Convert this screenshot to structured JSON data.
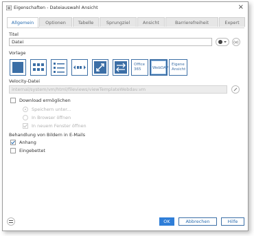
{
  "window": {
    "title": "Eigenschaften - Dateiauswahl Ansicht",
    "close_icon": "×"
  },
  "tabs": [
    {
      "label": "Allgemein",
      "active": true
    },
    {
      "label": "Optionen",
      "active": false
    },
    {
      "label": "Tabelle",
      "active": false
    },
    {
      "label": "Sprungziel",
      "active": false
    },
    {
      "label": "Ansicht",
      "active": false
    },
    {
      "label": "Barrierefreiheit",
      "active": false
    },
    {
      "label": "Expert",
      "active": false
    }
  ],
  "fields": {
    "titel_label": "Titel",
    "titel_value": "Datei",
    "vorlage_label": "Vorlage",
    "velocity_label": "Velocity-Datei",
    "velocity_value": "internal/system/vm/html/fileviews/viewTemplateWebdav.vm"
  },
  "templates": [
    {
      "name": "single-block",
      "text": ""
    },
    {
      "name": "grid",
      "text": ""
    },
    {
      "name": "list",
      "text": ""
    },
    {
      "name": "slider",
      "text": ""
    },
    {
      "name": "expand",
      "text": ""
    },
    {
      "name": "arrows",
      "text": ""
    },
    {
      "name": "office365",
      "text1": "Office",
      "text2": "365"
    },
    {
      "name": "webdav",
      "text1": "WebDAV",
      "selected": true
    },
    {
      "name": "eigene",
      "text1": "Eigene",
      "text2": "Ansicht"
    }
  ],
  "download": {
    "label": "Download ermöglichen",
    "options": [
      {
        "label": "Speichern unter..."
      },
      {
        "label": "In Browser öffnen"
      },
      {
        "label": "In neuem Fenster öffnen",
        "checked": true
      }
    ]
  },
  "images": {
    "label": "Behandlung von Bildern in E-Mails",
    "options": [
      {
        "label": "Anhang",
        "checked": true
      },
      {
        "label": "Eingebettet",
        "checked": false
      }
    ]
  },
  "buttons": {
    "ok": "OK",
    "cancel": "Abbrechen",
    "help": "Hilfe"
  },
  "colors": {
    "accent": "#2f7ed8",
    "template_border": "#3c6fa6"
  }
}
